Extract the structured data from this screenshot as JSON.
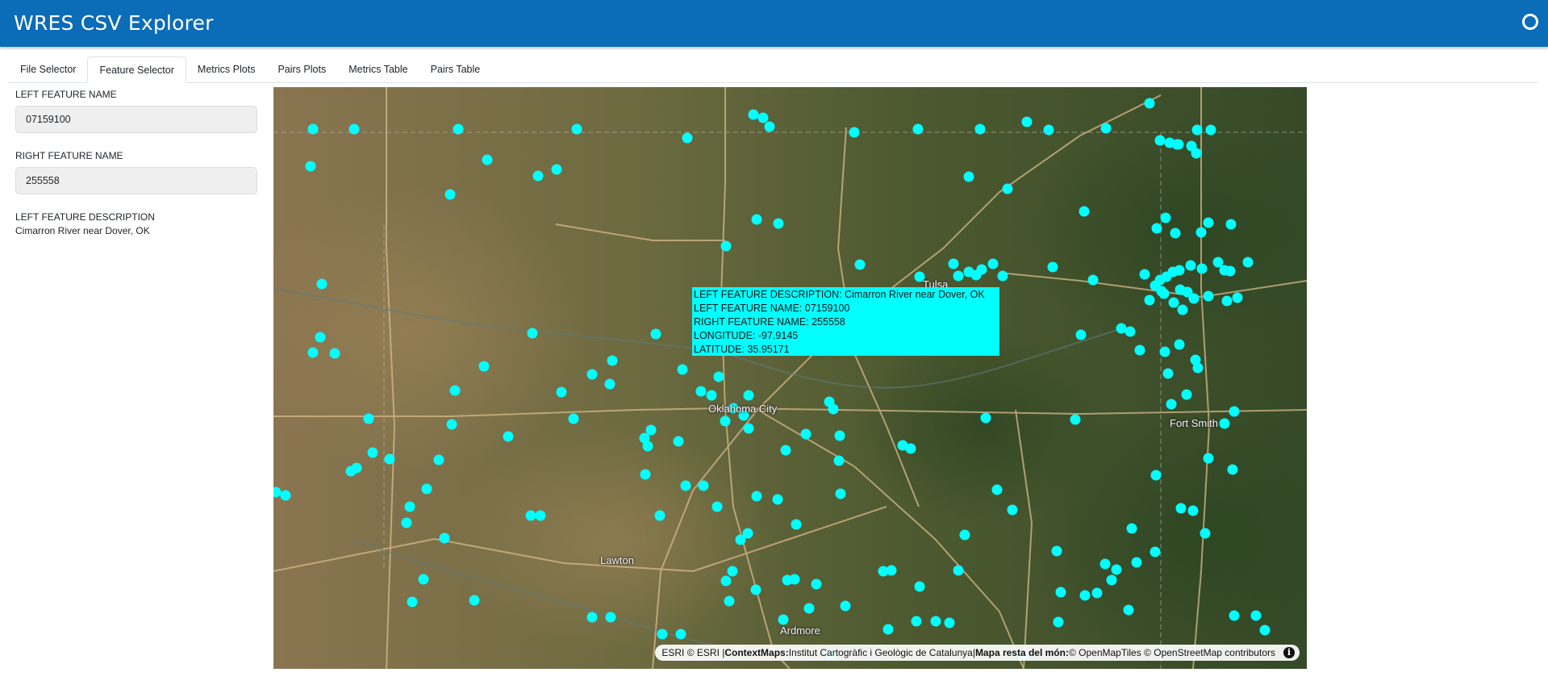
{
  "app": {
    "title": "WRES CSV Explorer"
  },
  "tabs": [
    {
      "label": "File Selector"
    },
    {
      "label": "Feature Selector",
      "active": true
    },
    {
      "label": "Metrics Plots"
    },
    {
      "label": "Pairs Plots"
    },
    {
      "label": "Metrics Table"
    },
    {
      "label": "Pairs Table"
    }
  ],
  "sidebar": {
    "left_name_label": "LEFT FEATURE NAME",
    "left_name_value": "07159100",
    "right_name_label": "RIGHT FEATURE NAME",
    "right_name_value": "255558",
    "left_desc_label": "LEFT FEATURE DESCRIPTION",
    "left_desc_value": "Cimarron River near Dover, OK"
  },
  "map": {
    "point_color": "#00ffff",
    "selected_color": "#e020e0",
    "place_labels": [
      "Oklahoma City",
      "Fort Smith",
      "Lawton",
      "Ardmore",
      "Tulsa"
    ],
    "tooltip": {
      "line1": "LEFT FEATURE DESCRIPTION: Cimarron River near Dover, OK",
      "line2": "LEFT FEATURE NAME: 07159100",
      "line3": "RIGHT FEATURE NAME: 255558",
      "line4": "LONGITUDE: -97.9145",
      "line5": "LATITUDE: 35.95171"
    },
    "attribution": {
      "esri": "ESRI © ESRI | ",
      "context_label": "ContextMaps:",
      "context_text": "Institut Cartogràfic i Geològic de Catalunya|",
      "rest_label": "Mapa resta del món:",
      "rest_text": "© OpenMapTiles © OpenStreetMap contributors"
    }
  }
}
